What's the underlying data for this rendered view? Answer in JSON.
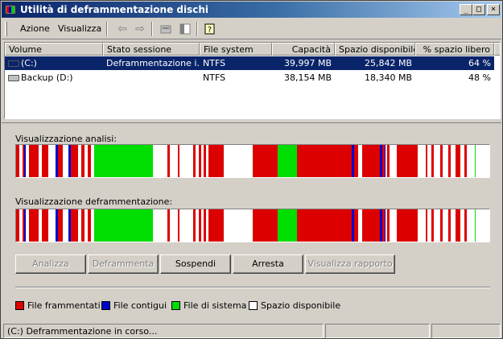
{
  "window": {
    "title": "Utilità di deframmentazione dischi"
  },
  "menu": {
    "azione": "Azione",
    "visualizza": "Visualizza"
  },
  "toolbar": {
    "icons": [
      "back-arrow-icon",
      "forward-arrow-icon",
      "drive-properties-icon",
      "view-icon",
      "help-icon"
    ]
  },
  "columns": [
    "Volume",
    "Stato sessione",
    "File system",
    "Capacità",
    "Spazio disponibile",
    "% spazio libero"
  ],
  "volumes": [
    {
      "name": "(C:)",
      "status": "Deframmentazione i...",
      "fs": "NTFS",
      "capacity": "39,997 MB",
      "free": "25,842 MB",
      "pct": "64 %",
      "selected": true
    },
    {
      "name": "Backup (D:)",
      "status": "",
      "fs": "NTFS",
      "capacity": "38,154 MB",
      "free": "18,340 MB",
      "pct": "48 %",
      "selected": false
    }
  ],
  "labels": {
    "analysis": "Visualizzazione analisi:",
    "defrag": "Visualizzazione deframmentazione:"
  },
  "buttons": {
    "analyze": "Analizza",
    "defragment": "Deframmenta",
    "pause": "Sospendi",
    "stop": "Arresta",
    "report": "Visualizza rapporto"
  },
  "legend": {
    "fragmented": "File frammentati",
    "contiguous": "File contigui",
    "system": "File di sistema",
    "free": "Spazio disponibile"
  },
  "colors": {
    "fragmented": "#dd0000",
    "contiguous": "#0000cc",
    "system": "#00dd00",
    "free": "#ffffff"
  },
  "status": {
    "text": "(C:) Deframmentazione in corso..."
  }
}
